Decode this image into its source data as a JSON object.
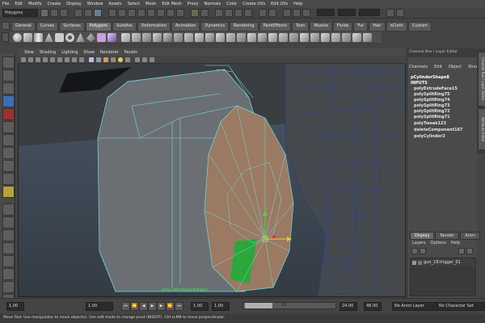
{
  "menubar": {
    "items": [
      "File",
      "Edit",
      "Modify",
      "Create",
      "Display",
      "Window",
      "Assets",
      "Select",
      "Mesh",
      "Edit Mesh",
      "Proxy",
      "Normals",
      "Color",
      "Create UVs",
      "Edit UVs",
      "Help"
    ]
  },
  "status_line": {
    "mode": "Polygons"
  },
  "shelf": {
    "tabs": [
      "General",
      "Curves",
      "Surfaces",
      "Polygons",
      "Subdivs",
      "Deformation",
      "Animation",
      "Dynamics",
      "Rendering",
      "PaintEffects",
      "Toon",
      "Muscle",
      "Fluids",
      "Fur",
      "Hair",
      "nCloth",
      "Custom"
    ],
    "active_tab": "Polygons"
  },
  "panel": {
    "menu": [
      "View",
      "Shading",
      "Lighting",
      "Show",
      "Renderer",
      "Panels"
    ],
    "camera_label": "persp (default)(perspShape)"
  },
  "channel_box": {
    "title": "Channel Box / Layer Editor",
    "menu": [
      "Channels",
      "Edit",
      "Object",
      "Show"
    ],
    "shape_name": "pCylinderShape8",
    "inputs_label": "INPUTS",
    "history": [
      "polyExtrudeFace15",
      "polySplitRing75",
      "polySplitRing74",
      "polySplitRing73",
      "polySplitRing72",
      "polySplitRing71",
      "polyTweak123",
      "deleteComponent167",
      "polyCylinder2"
    ]
  },
  "side_tabs": [
    "Channel Box / Layer Editor",
    "Attribute Editor"
  ],
  "layer_editor": {
    "tabs": [
      "Display",
      "Render",
      "Anim"
    ],
    "active_tab": "Display",
    "menu": [
      "Layers",
      "Options",
      "Help"
    ],
    "layers": [
      {
        "name": "gun_18:trigger_01"
      }
    ]
  },
  "timeline": {
    "start_field": "1.00",
    "current_field": "1.00",
    "range_start": "1.00",
    "range_start2": "1.00",
    "range_mid": "24",
    "range_end": "24.00",
    "range_end2": "48.00",
    "current_frame": "1.00",
    "anim_layer": "No Anim Layer",
    "character_set": "No Character Set"
  },
  "help_line": "Move Tool: Use manipulator to move object(s). Use edit mode to change pivot (INSERT). Ctrl+LMB to move perpendicular.",
  "colors": {
    "viewport_bg": "#3f4a56",
    "wire_highlight": "#6ee0e8",
    "selected_face": "#2aa83a",
    "face_tint": "#9a7a62"
  }
}
